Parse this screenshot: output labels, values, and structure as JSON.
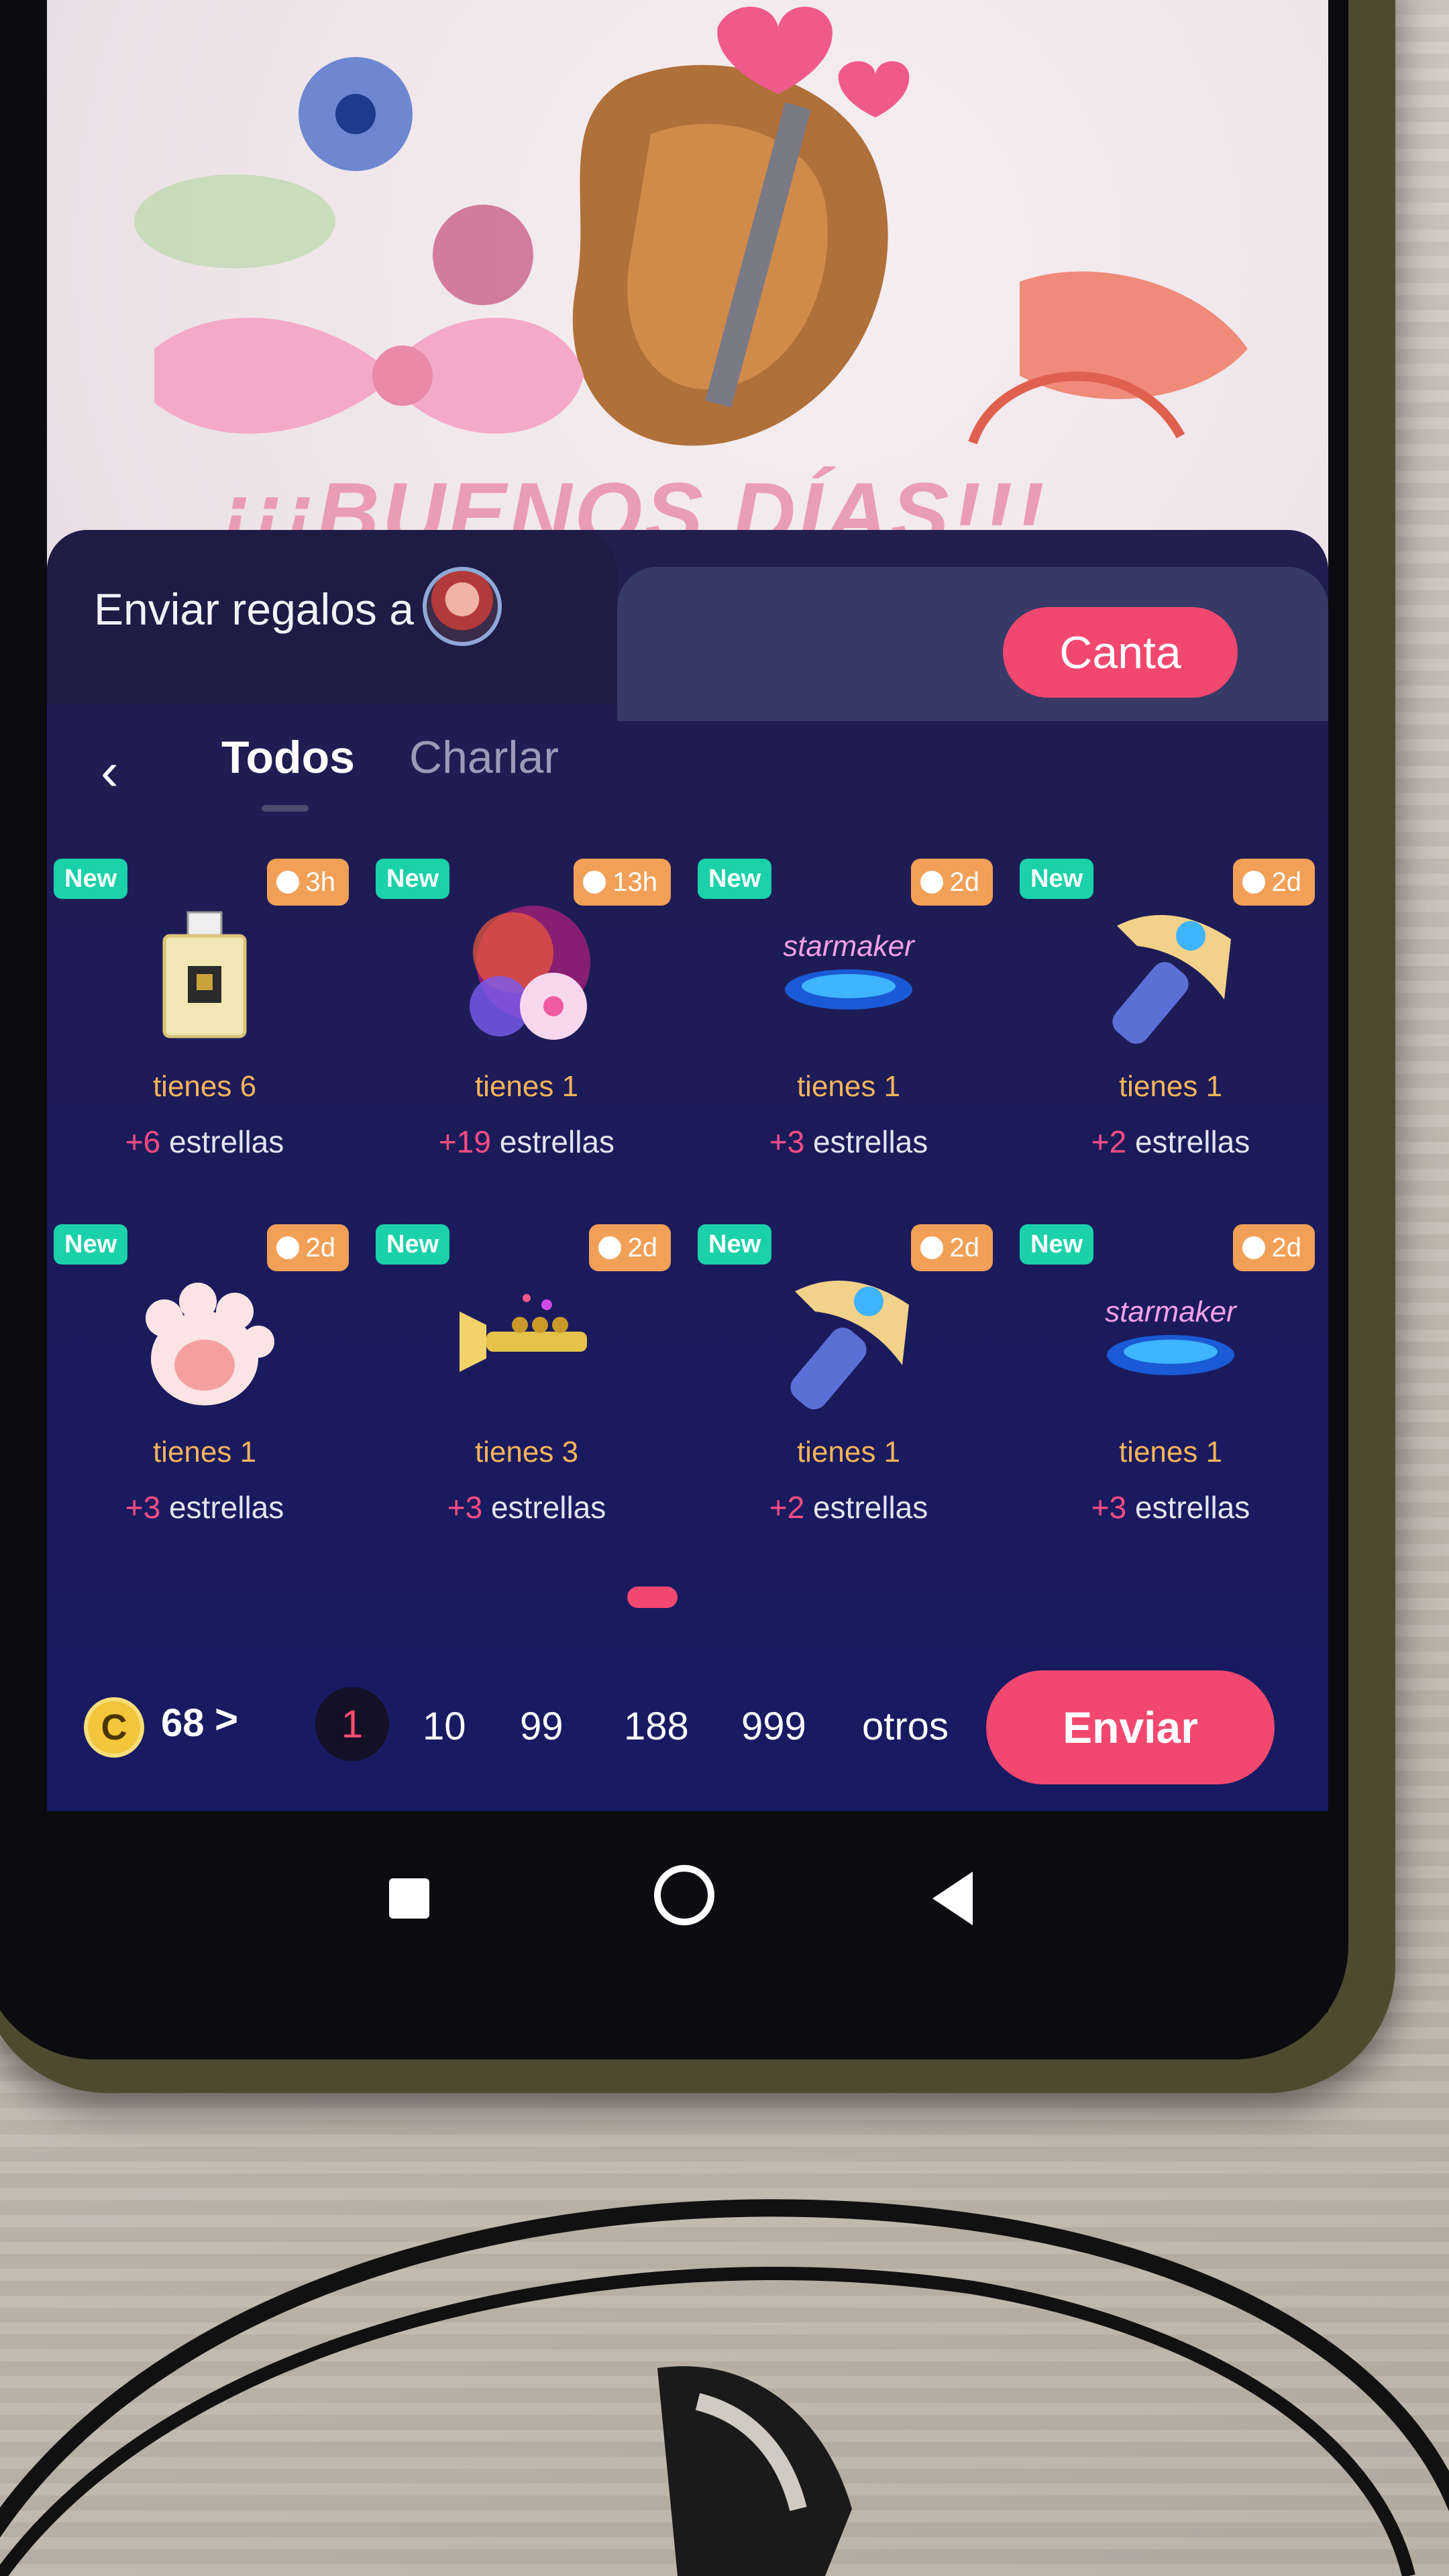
{
  "background_card": {
    "caption": "¡¡¡BUENOS DÍAS!!!"
  },
  "gift_panel": {
    "send_to_label": "Enviar regalos a",
    "canta_label": "Canta",
    "back_glyph": "‹",
    "tabs": [
      {
        "label": "Todos",
        "active": true
      },
      {
        "label": "Charlar",
        "active": false
      }
    ],
    "gifts": [
      {
        "icon": "perfume-bottle-icon",
        "new_badge": "New",
        "time": "3h",
        "have": "tienes 6",
        "stars_plus": "+6",
        "stars_label": "estrellas"
      },
      {
        "icon": "fireworks-icon",
        "new_badge": "New",
        "time": "13h",
        "have": "tienes 1",
        "stars_plus": "+19",
        "stars_label": "estrellas"
      },
      {
        "icon": "starmaker-stage-icon",
        "new_badge": "New",
        "time": "2d",
        "have": "tienes 1",
        "stars_plus": "+3",
        "stars_label": "estrellas",
        "logo_text": "starmaker"
      },
      {
        "icon": "pickaxe-icon",
        "new_badge": "New",
        "time": "2d",
        "have": "tienes 1",
        "stars_plus": "+2",
        "stars_label": "estrellas"
      },
      {
        "icon": "paw-print-icon",
        "new_badge": "New",
        "time": "2d",
        "have": "tienes 1",
        "stars_plus": "+3",
        "stars_label": "estrellas"
      },
      {
        "icon": "trumpet-icon",
        "new_badge": "New",
        "time": "2d",
        "have": "tienes 3",
        "stars_plus": "+3",
        "stars_label": "estrellas"
      },
      {
        "icon": "pickaxe-icon",
        "new_badge": "New",
        "time": "2d",
        "have": "tienes 1",
        "stars_plus": "+2",
        "stars_label": "estrellas"
      },
      {
        "icon": "starmaker-stage-icon",
        "new_badge": "New",
        "time": "2d",
        "have": "tienes 1",
        "stars_plus": "+3",
        "stars_label": "estrellas",
        "logo_text": "starmaker"
      }
    ],
    "coins": {
      "symbol": "C",
      "count": "68",
      "chevron": ">"
    },
    "quantities": [
      {
        "label": "1",
        "selected": true
      },
      {
        "label": "10",
        "selected": false
      },
      {
        "label": "99",
        "selected": false
      },
      {
        "label": "188",
        "selected": false
      },
      {
        "label": "999",
        "selected": false
      },
      {
        "label": "otros",
        "selected": false
      }
    ],
    "send_label": "Enviar",
    "colors": {
      "accent": "#f2486f",
      "new_badge": "#1ad1a9",
      "time_badge": "#f2a057",
      "have_text": "#f7b45a"
    }
  },
  "system_nav": {
    "buttons": [
      "recents-square-icon",
      "home-circle-icon",
      "back-triangle-icon"
    ]
  }
}
